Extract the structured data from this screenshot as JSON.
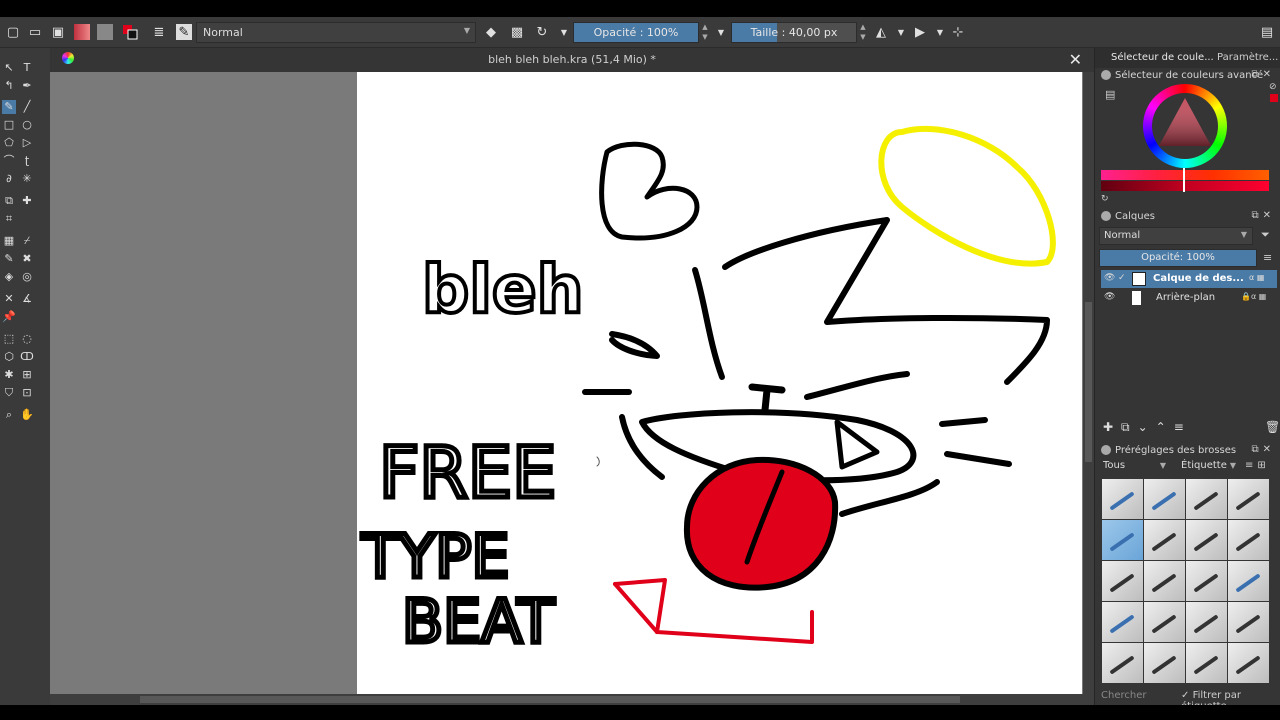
{
  "toolbar": {
    "blend_mode": "Normal",
    "opacity_label": "Opacité : 100%",
    "size_label": "Taille : 40,00 px"
  },
  "document": {
    "title": "bleh bleh bleh.kra (51,4 Mio) *"
  },
  "dock": {
    "tabs": [
      "Sélecteur de coule...",
      "Paramètre..."
    ],
    "color_panel_title": "Sélecteur de couleurs avancé",
    "layers_panel_title": "Calques",
    "layers_blend_mode": "Normal",
    "layers_opacity": "Opacité: 100%",
    "layers": [
      {
        "name": "Calque de des...",
        "selected": true
      },
      {
        "name": "Arrière-plan",
        "selected": false
      }
    ],
    "brush_panel_title": "Préréglages des brosses",
    "brush_filter": "Tous",
    "brush_tag": "Étiquette",
    "search_placeholder": "Chercher",
    "filter_by_tag": "Filtrer par étiquette"
  },
  "drawing": {
    "text_bleh": "bleh",
    "text_free": "FREE",
    "text_type": "TYPE",
    "text_beat": "BEAT"
  },
  "colors": {
    "fg": "#e0001a",
    "halo": "#f5f000",
    "accent": "#4a7aa6"
  }
}
